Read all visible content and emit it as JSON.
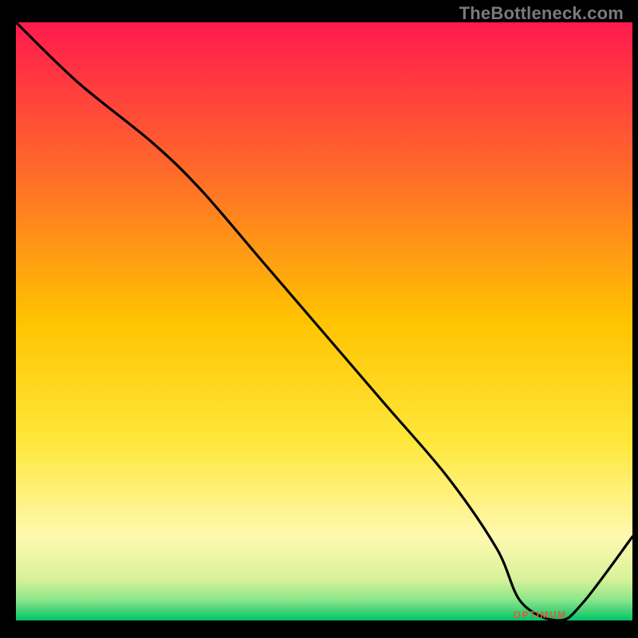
{
  "watermark": "TheBottleneck.com",
  "chart_data": {
    "type": "line",
    "title": "",
    "xlabel": "",
    "ylabel": "",
    "xlim": [
      0,
      100
    ],
    "ylim": [
      0,
      100
    ],
    "grid": false,
    "legend": false,
    "axes_visible": false,
    "background": {
      "type": "vertical-gradient",
      "stops": [
        {
          "pos": 0.0,
          "color": "#ff1a4d"
        },
        {
          "pos": 0.25,
          "color": "#ff6a2a"
        },
        {
          "pos": 0.5,
          "color": "#ffc400"
        },
        {
          "pos": 0.7,
          "color": "#ffe73a"
        },
        {
          "pos": 0.86,
          "color": "#fff9b0"
        },
        {
          "pos": 0.93,
          "color": "#d9f29a"
        },
        {
          "pos": 0.965,
          "color": "#8ee68a"
        },
        {
          "pos": 1.0,
          "color": "#00c466"
        }
      ]
    },
    "series": [
      {
        "name": "curve",
        "color": "#000000",
        "x": [
          0,
          10,
          22,
          30,
          40,
          50,
          60,
          70,
          78,
          82,
          88,
          92,
          100
        ],
        "values": [
          100,
          90,
          80,
          72,
          60,
          48,
          36,
          24,
          12,
          3,
          0,
          3,
          14
        ]
      }
    ],
    "annotation": {
      "label_approx": "OPTIMUM",
      "x": 85,
      "y": 0,
      "color": "#e4573d"
    }
  }
}
